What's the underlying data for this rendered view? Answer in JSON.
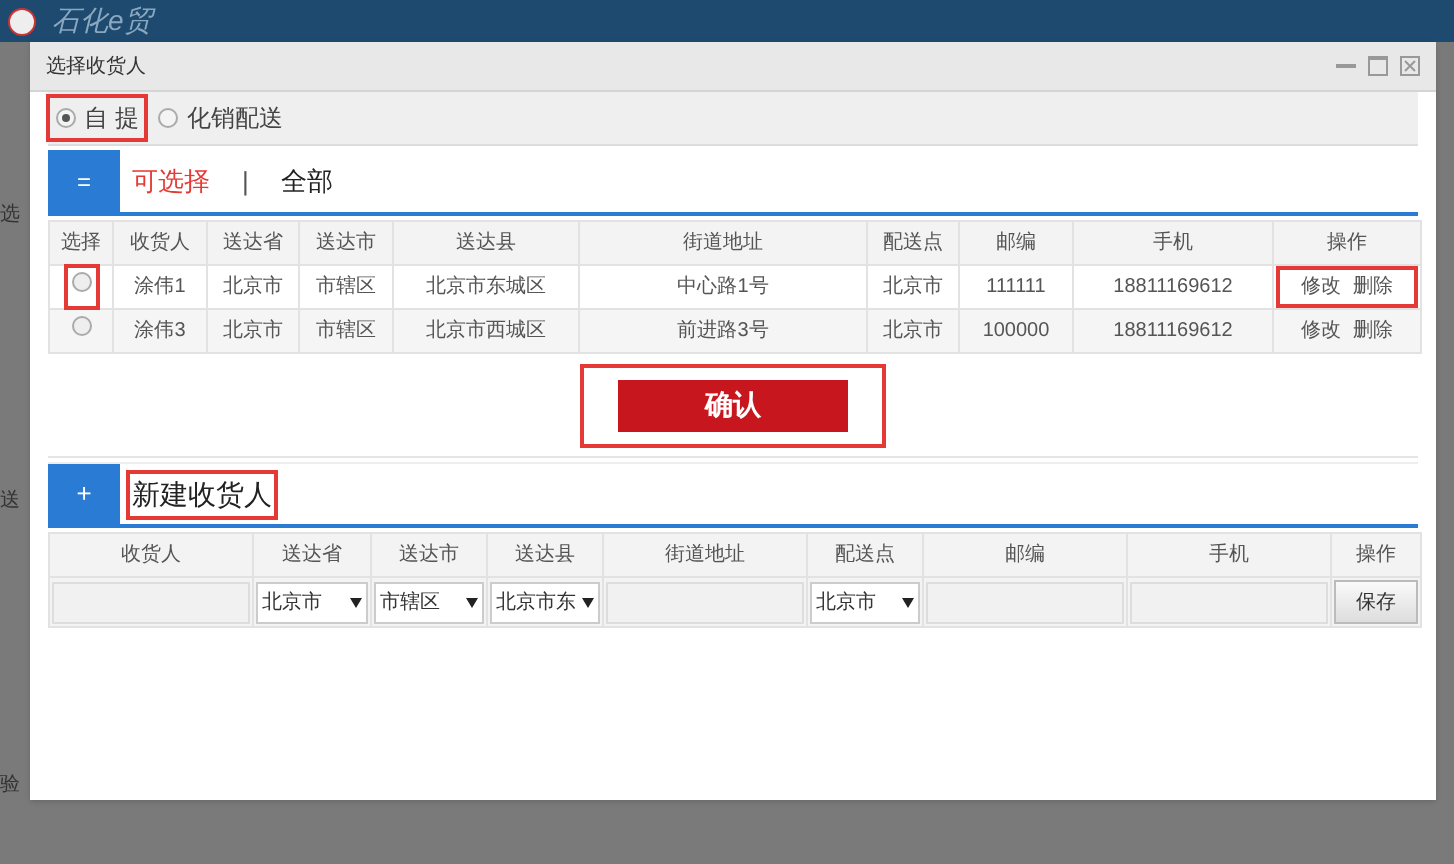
{
  "background": {
    "logo_text": "石化e贸",
    "fragments": [
      "选",
      "送",
      "验"
    ]
  },
  "dialog": {
    "title": "选择收货人"
  },
  "delivery_options": [
    {
      "label": "自 提",
      "selected": true,
      "highlighted": true
    },
    {
      "label": "化销配送",
      "selected": false,
      "highlighted": false
    }
  ],
  "list_section": {
    "icon_text": "=",
    "separator": "|",
    "filters": [
      {
        "label": "可选择",
        "selected": true
      },
      {
        "label": "全部",
        "selected": false
      }
    ]
  },
  "consignee_table": {
    "select_column": "选择",
    "columns": [
      "收货人",
      "送达省",
      "送达市",
      "送达县",
      "街道地址",
      "配送点",
      "邮编",
      "手机"
    ],
    "actions_column": "操作",
    "rows": [
      {
        "selected": false,
        "highlighted": true,
        "actions_highlighted": true,
        "cells": [
          "涂伟1",
          "北京市",
          "市辖区",
          "北京市东城区",
          "中心路1号",
          "北京市",
          "111111",
          "18811169612"
        ],
        "actions": [
          "修改",
          "删除"
        ]
      },
      {
        "selected": false,
        "highlighted": false,
        "actions_highlighted": false,
        "cells": [
          "涂伟3",
          "北京市",
          "市辖区",
          "北京市西城区",
          "前进路3号",
          "北京市",
          "100000",
          "18811169612"
        ],
        "actions": [
          "修改",
          "删除"
        ]
      }
    ]
  },
  "confirm_button": {
    "label": "确认",
    "highlighted": true
  },
  "new_section": {
    "icon_text": "+",
    "title": "新建收货人",
    "highlighted": true
  },
  "new_table": {
    "columns": [
      "收货人",
      "送达省",
      "送达市",
      "送达县",
      "街道地址",
      "配送点",
      "邮编",
      "手机",
      "操作"
    ],
    "fields": [
      {
        "kind": "input"
      },
      {
        "kind": "select",
        "value": "北京市"
      },
      {
        "kind": "select",
        "value": "市辖区"
      },
      {
        "kind": "select",
        "value": "北京市东"
      },
      {
        "kind": "input"
      },
      {
        "kind": "select",
        "value": "北京市"
      },
      {
        "kind": "input"
      },
      {
        "kind": "input"
      },
      {
        "kind": "button",
        "label": "保存"
      }
    ]
  }
}
